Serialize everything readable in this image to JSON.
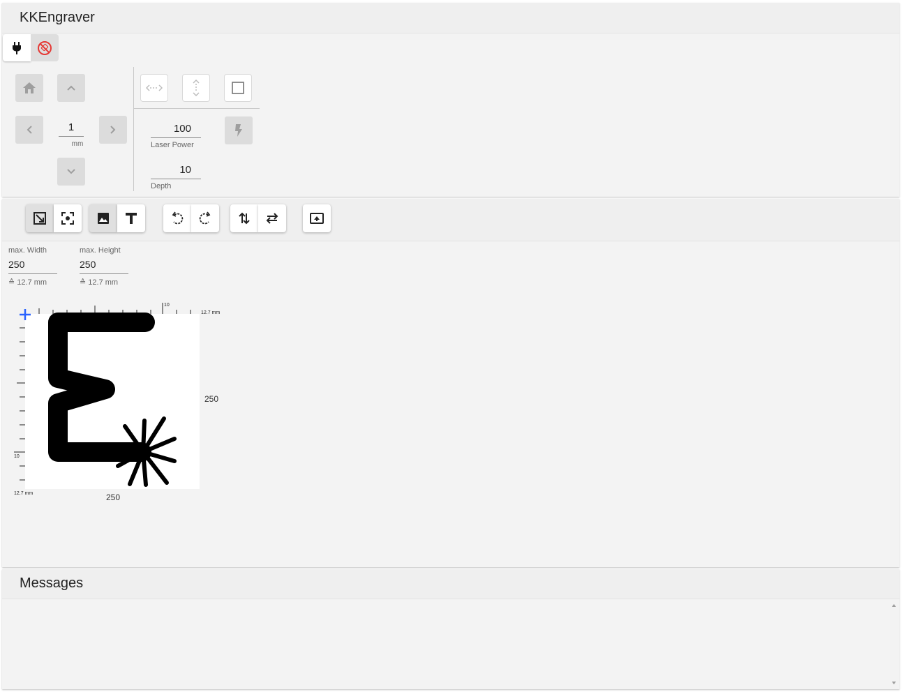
{
  "app": {
    "title": "KKEngraver"
  },
  "connection": {
    "connect_icon": "plug-icon",
    "disconnect_icon": "no-connection-icon"
  },
  "jog": {
    "step_value": "1",
    "step_unit": "mm"
  },
  "laser": {
    "power_value": "100",
    "power_label": "Laser Power",
    "depth_value": "10",
    "depth_label": "Depth"
  },
  "image_settings": {
    "max_width_label": "max. Width",
    "max_width_value": "250",
    "max_width_mm": "≙ 12.7 mm",
    "max_height_label": "max. Height",
    "max_height_value": "250",
    "max_height_mm": "≙ 12.7 mm"
  },
  "preview": {
    "ruler_mark": "10",
    "ruler_end_top": "12.7 mm",
    "ruler_end_left": "12.7 mm",
    "ruler_mark_left": "10",
    "height_px": "250",
    "width_px": "250",
    "origin_color": "#2962ff"
  },
  "messages": {
    "title": "Messages"
  }
}
